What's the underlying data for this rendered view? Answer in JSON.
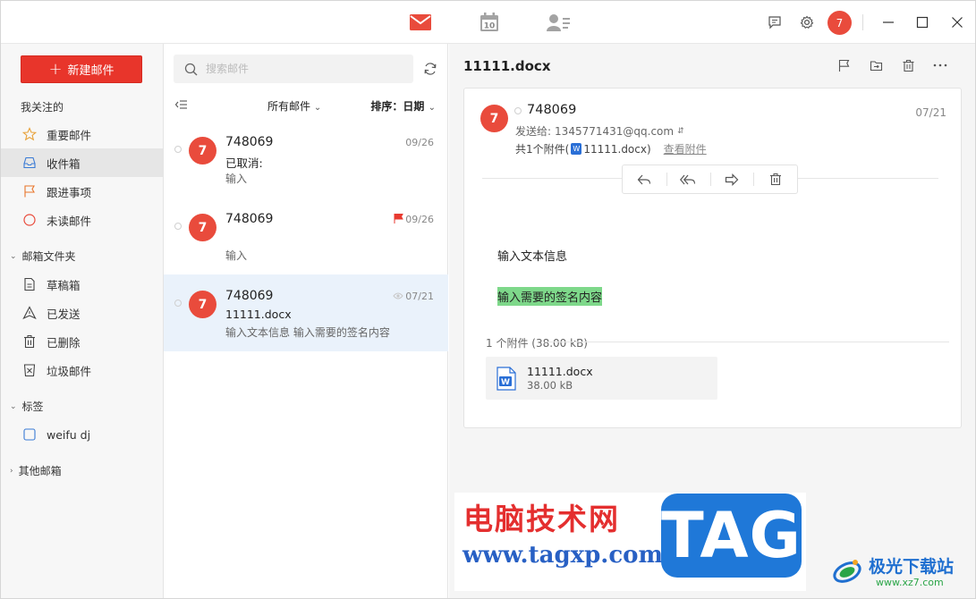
{
  "titlebar": {
    "tabs": [
      {
        "name": "mail",
        "icon": "mail-icon"
      },
      {
        "name": "calendar",
        "icon": "calendar-icon",
        "day": "10"
      },
      {
        "name": "contacts",
        "icon": "contacts-icon"
      }
    ],
    "avatar_initial": "7",
    "accent_color": "#e94b3c"
  },
  "sidebar": {
    "compose_label": "新建邮件",
    "favorites_heading": "我关注的",
    "favorites": [
      {
        "label": "重要邮件",
        "icon": "star-icon"
      },
      {
        "label": "收件箱",
        "icon": "inbox-icon",
        "active": true
      },
      {
        "label": "跟进事项",
        "icon": "flag-icon"
      },
      {
        "label": "未读邮件",
        "icon": "unread-circle-icon"
      }
    ],
    "folders_heading": "邮箱文件夹",
    "folders": [
      {
        "label": "草稿箱",
        "icon": "draft-icon"
      },
      {
        "label": "已发送",
        "icon": "sent-icon"
      },
      {
        "label": "已删除",
        "icon": "trash-icon"
      },
      {
        "label": "垃圾邮件",
        "icon": "junk-icon"
      }
    ],
    "tags_heading": "标签",
    "tags": [
      {
        "label": "weifu dj",
        "icon": "tag-checkbox-icon"
      }
    ],
    "other_heading": "其他邮箱"
  },
  "list": {
    "search_placeholder": "搜索邮件",
    "filter_label": "所有邮件",
    "sort_prefix": "排序：",
    "sort_value": "日期",
    "items": [
      {
        "avatar": "7",
        "from": "748069",
        "date": "09/26",
        "subject": "已取消:",
        "preview": "输入",
        "flagged": false
      },
      {
        "avatar": "7",
        "from": "748069",
        "date": "09/26",
        "subject": "",
        "preview": "输入",
        "flagged": true
      },
      {
        "avatar": "7",
        "from": "748069",
        "date": "07/21",
        "subject": "11111.docx",
        "preview": "输入文本信息 输入需要的签名内容",
        "flagged": false,
        "selected": true
      }
    ]
  },
  "reader": {
    "title": "11111.docx",
    "from": "748069",
    "date": "07/21",
    "to_prefix": "发送给:",
    "to_address": "1345771431@qq.com",
    "attach_summary_prefix": "共1个附件(",
    "attach_summary_name": "11111.docx",
    "attach_summary_suffix": ")",
    "view_attachments": "查看附件",
    "body_line1": "输入文本信息",
    "body_line2": "输入需要的签名内容",
    "attachments_heading": "1 个附件 (38.00 kB)",
    "attachment": {
      "name": "11111.docx",
      "size": "38.00 kB"
    },
    "highlight_color": "#7ed88a"
  },
  "watermark": {
    "site_name": "电脑技术网",
    "site_url": "www.tagxp.com",
    "tag": "TAG",
    "brand2_name": "极光下载站",
    "brand2_url": "www.xz7.com"
  }
}
